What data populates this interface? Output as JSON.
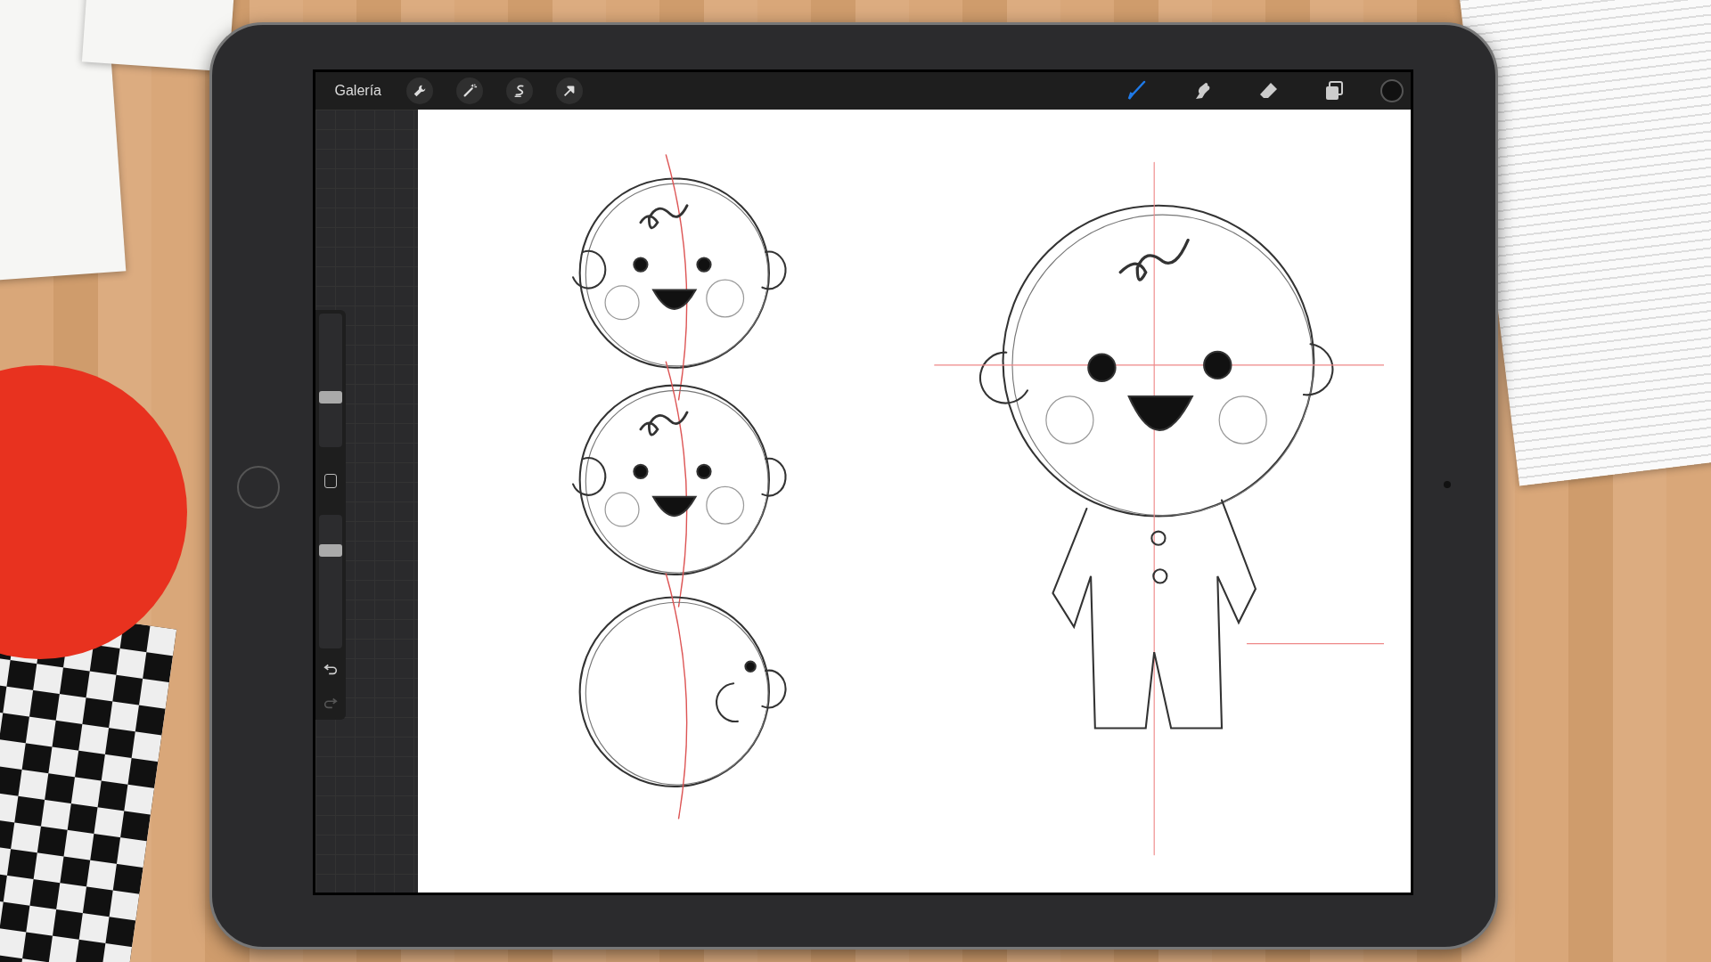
{
  "toolbar": {
    "gallery": "Galería",
    "left_tools": [
      {
        "kind": "wrench"
      },
      {
        "kind": "wand"
      },
      {
        "kind": "selection"
      },
      {
        "kind": "transform"
      }
    ],
    "right_tools": [
      {
        "kind": "brush",
        "selected": true
      },
      {
        "kind": "smudge",
        "selected": false
      },
      {
        "kind": "eraser",
        "selected": false
      },
      {
        "kind": "layers",
        "selected": false
      }
    ],
    "color": "#111111"
  },
  "sidebar": {
    "sliders": [
      {
        "level": 0.38
      },
      {
        "level": 0.74
      }
    ]
  }
}
